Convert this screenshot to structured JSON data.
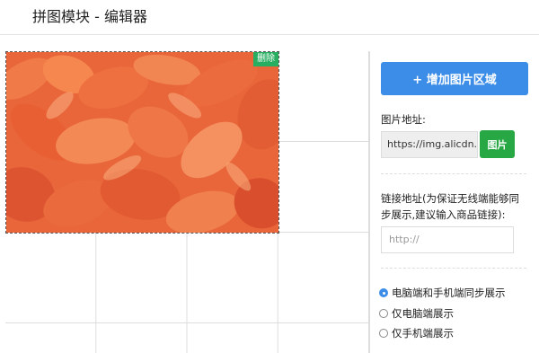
{
  "header": {
    "title": "拼图模块 - 编辑器"
  },
  "image_area": {
    "delete_label": "删除"
  },
  "panel": {
    "add_button_label": "+ 增加图片区域",
    "image_address_label": "图片地址:",
    "image_address_value": "https://img.alicdn.",
    "image_button_label": "图片",
    "link_address_label_line1": "链接地址(为保证无线端能够同",
    "link_address_label_line2": "步展示,建议输入商品链接):",
    "link_placeholder": "http://",
    "display_options": [
      {
        "label": "电脑端和手机端同步展示",
        "checked": true
      },
      {
        "label": "仅电脑端展示",
        "checked": false
      },
      {
        "label": "仅手机端展示",
        "checked": false
      }
    ]
  },
  "colors": {
    "accent": "#3c8de8",
    "success": "#28a745",
    "petal_base": "#e86a3c"
  }
}
